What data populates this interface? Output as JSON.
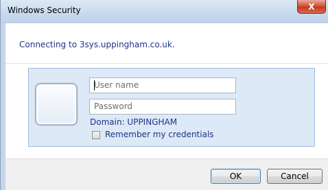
{
  "window": {
    "title": "Windows Security",
    "close_glyph": "X",
    "icon": "close-icon"
  },
  "dialog": {
    "connecting_text": "Connecting to 3sys.uppingham.co.uk."
  },
  "credentials": {
    "avatar_icon": "user-tile-icon",
    "username": {
      "placeholder": "User name",
      "value": ""
    },
    "password": {
      "placeholder": "Password",
      "value": ""
    },
    "domain_text": "Domain: UPPINGHAM",
    "remember_label": "Remember my credentials",
    "remember_checked": false
  },
  "footer": {
    "ok_label": "OK",
    "cancel_label": "Cancel"
  },
  "colors": {
    "text_blue": "#1e3287",
    "credential_box_bg": "#dde9f6",
    "close_red": "#c23a1f"
  }
}
